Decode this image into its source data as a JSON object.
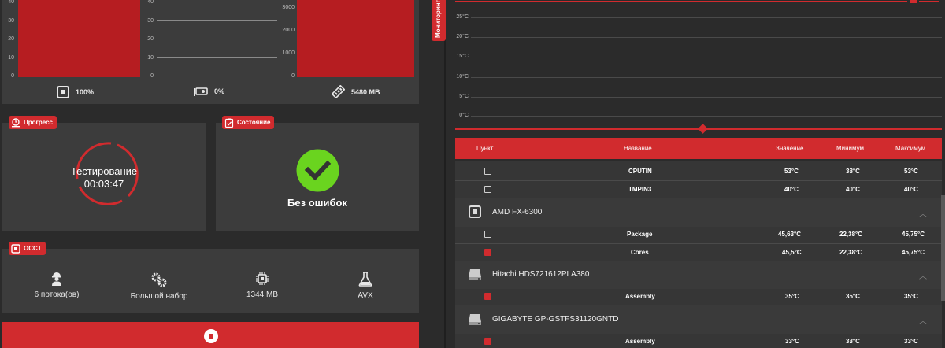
{
  "colors": {
    "accent": "#d12b2e",
    "bar": "#b61d21",
    "panel": "#3c3c3c",
    "bg": "#2b2b2b",
    "ok": "#6ad41f"
  },
  "charts": [
    {
      "type": "area",
      "ticks": [
        "40",
        "30",
        "20",
        "10",
        "0"
      ],
      "fill_fraction": 1.0
    },
    {
      "type": "area",
      "ticks": [
        "40",
        "30",
        "20",
        "10",
        "0"
      ],
      "fill_fraction": 0.0
    },
    {
      "type": "area",
      "ticks": [
        "3000",
        "2000",
        "1000",
        "0"
      ],
      "fill_fraction": 1.0
    }
  ],
  "stats": {
    "cpu": {
      "icon": "cpu-icon",
      "value": "100%"
    },
    "gpu": {
      "icon": "gpu-icon",
      "value": "0%"
    },
    "ram": {
      "icon": "ram-icon",
      "value": "5480 MB"
    }
  },
  "progress": {
    "tag": "Прогресс",
    "icon": "clock-icon",
    "label": "Тестирование",
    "time": "00:03:47"
  },
  "status": {
    "tag": "Состояние",
    "icon": "clipboard-check-icon",
    "label": "Без ошибок"
  },
  "occt": {
    "tag": "OCCT",
    "items": [
      {
        "icon": "worker-icon",
        "label": "6 потока(ов)"
      },
      {
        "icon": "gears-icon",
        "label": "Большой набор"
      },
      {
        "icon": "chip-icon",
        "label": "1344 MB"
      },
      {
        "icon": "flask-icon",
        "label": "AVX"
      }
    ]
  },
  "stop_button": {
    "icon": "stop-icon"
  },
  "monitoring": {
    "tab_label": "Мониторинг",
    "chart_data": {
      "type": "line",
      "ylabels": [
        "25°C",
        "20°C",
        "15°C",
        "10°C",
        "5°C",
        "0°C"
      ],
      "ylim": [
        0,
        25
      ]
    }
  },
  "table": {
    "headers": {
      "item": "Пункт",
      "name": "Название",
      "value": "Значение",
      "min": "Минимум",
      "max": "Максимум"
    },
    "rows_a": [
      {
        "name": "CPUTIN",
        "checked": false,
        "value": "53°C",
        "min": "38°C",
        "max": "53°C"
      },
      {
        "name": "TMPIN3",
        "checked": false,
        "value": "40°C",
        "min": "40°C",
        "max": "40°C"
      }
    ],
    "group_cpu": {
      "name": "AMD FX-6300",
      "icon": "cpu-icon"
    },
    "rows_cpu": [
      {
        "name": "Package",
        "checked": false,
        "value": "45,63°C",
        "min": "22,38°C",
        "max": "45,75°C"
      },
      {
        "name": "Cores",
        "checked": true,
        "value": "45,5°C",
        "min": "22,38°C",
        "max": "45,75°C"
      }
    ],
    "group_hdd1": {
      "name": "Hitachi HDS721612PLA380",
      "icon": "hdd-icon"
    },
    "rows_hdd1": [
      {
        "name": "Assembly",
        "checked": true,
        "value": "35°C",
        "min": "35°C",
        "max": "35°C"
      }
    ],
    "group_hdd2": {
      "name": "GIGABYTE GP-GSTFS31120GNTD",
      "icon": "hdd-icon"
    },
    "rows_hdd2": [
      {
        "name": "Assembly",
        "checked": true,
        "value": "33°C",
        "min": "33°C",
        "max": "33°C"
      }
    ]
  }
}
